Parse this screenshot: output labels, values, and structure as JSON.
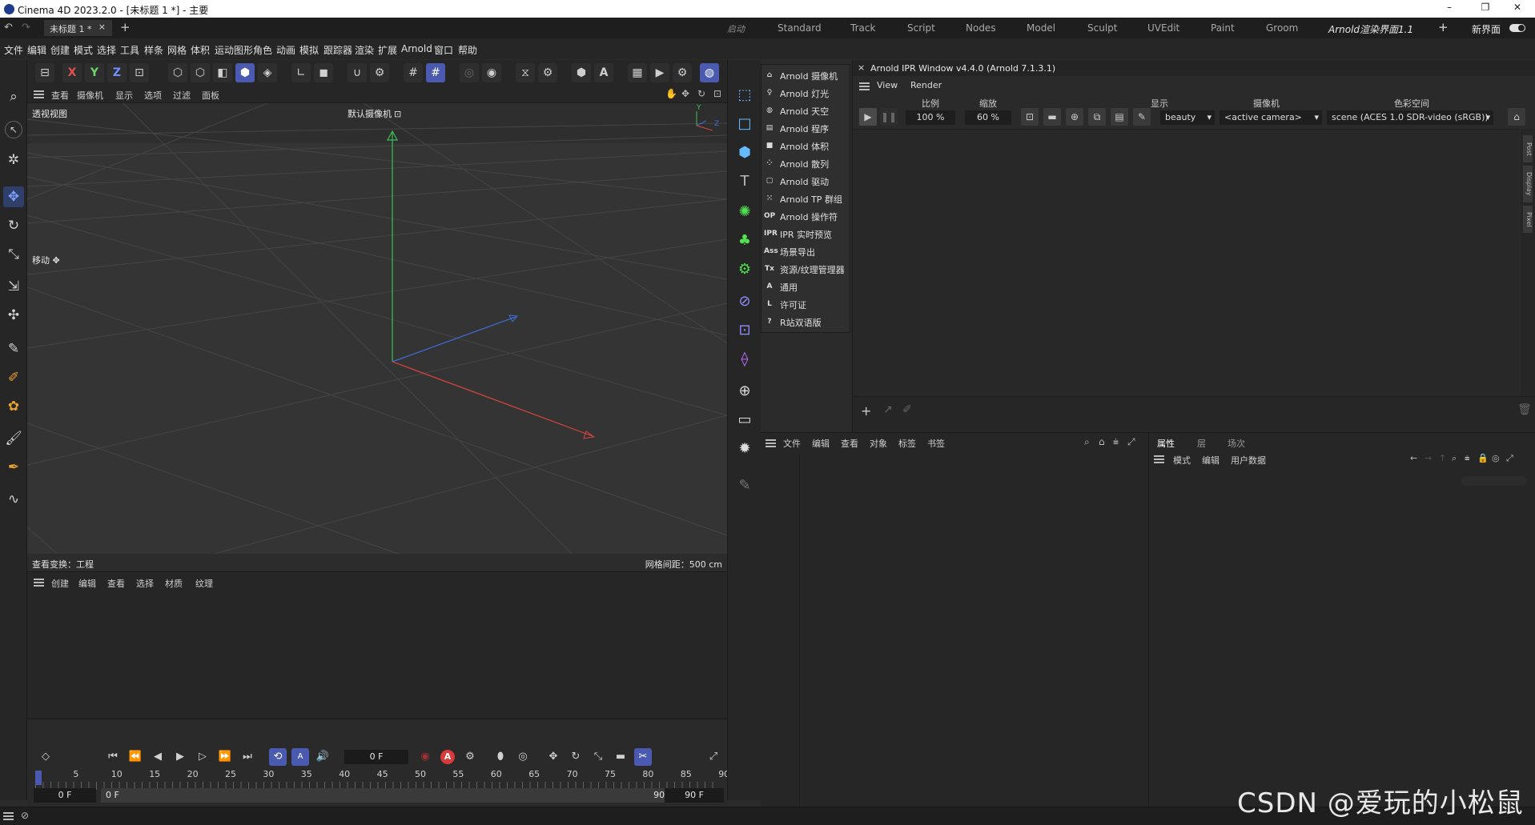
{
  "window": {
    "title": "Cinema 4D 2023.2.0 - [未标题 1 *] - 主要",
    "minimize": "–",
    "restore": "❐",
    "close": "✕"
  },
  "tabs": {
    "doc_tab": "未标题 1 *",
    "doc_close": "×",
    "add": "+",
    "layouts": [
      "启动",
      "Standard",
      "Track",
      "Script",
      "Nodes",
      "Model",
      "Sculpt",
      "UVEdit",
      "Paint",
      "Groom",
      "Arnold渲染界面1.1"
    ],
    "add_layout": "+",
    "new_layout": "新界面"
  },
  "menu": [
    "文件",
    "编辑",
    "创建",
    "模式",
    "选择",
    "工具",
    "样条",
    "网格",
    "体积",
    "运动图形",
    "角色",
    "动画",
    "模拟",
    "跟踪器",
    "渲染",
    "扩展",
    "Arnold",
    "窗口",
    "帮助"
  ],
  "toolbar": {
    "axis_x": "X",
    "axis_y": "Y",
    "axis_z": "Z"
  },
  "viewport": {
    "menu": [
      "查看",
      "摄像机",
      "显示",
      "选项",
      "过滤",
      "面板"
    ],
    "view_name": "透视视图",
    "camera": "默认摄像机",
    "camera_icon": "⊡",
    "tool_label": "移动",
    "tool_icon": "✥",
    "status_left": "查看变换：工程",
    "status_right": "网格间距：500 cm",
    "axis_y_label": "Y",
    "axis_z_label": "Z"
  },
  "material_panel": {
    "menu": [
      "创建",
      "编辑",
      "查看",
      "选择",
      "材质",
      "纹理"
    ]
  },
  "timeline": {
    "current_frame": "0 F",
    "ticks": [
      "0",
      "5",
      "10",
      "15",
      "20",
      "25",
      "30",
      "35",
      "40",
      "45",
      "50",
      "55",
      "60",
      "65",
      "70",
      "75",
      "80",
      "85",
      "90"
    ],
    "start_field": "0 F",
    "range_start": "0 F",
    "range_end": "90 F",
    "end_field": "90 F",
    "record_label": "A"
  },
  "arnold_menu": [
    {
      "icon": "⌂",
      "label": "Arnold 摄像机"
    },
    {
      "icon": "♀",
      "label": "Arnold 灯光"
    },
    {
      "icon": "◍",
      "label": "Arnold 天空"
    },
    {
      "icon": "▤",
      "label": "Arnold 程序"
    },
    {
      "icon": "■",
      "label": "Arnold 体积"
    },
    {
      "icon": "⁘",
      "label": "Arnold 散列"
    },
    {
      "icon": "▢",
      "label": "Arnold 驱动"
    },
    {
      "icon": "⁙",
      "label": "Arnold TP 群组"
    },
    {
      "icon": "OP",
      "label": "Arnold 操作符"
    },
    {
      "icon": "IPR",
      "label": "IPR 实时预览"
    },
    {
      "icon": "Ass",
      "label": "场景导出"
    },
    {
      "icon": "Tx",
      "label": "资源/纹理管理器"
    },
    {
      "icon": "A",
      "label": "通用"
    },
    {
      "icon": "L",
      "label": "许可证"
    },
    {
      "icon": "?",
      "label": "R站双语版"
    }
  ],
  "ipr": {
    "title": "Arnold IPR Window v4.4.0 (Arnold 7.1.3.1)",
    "close": "×",
    "menu": [
      "View",
      "Render"
    ],
    "scale_label": "比例",
    "scale_value": "100 %",
    "zoom_label": "缩放",
    "zoom_value": "60 %",
    "display_label": "显示",
    "display_value": "beauty",
    "camera_label": "摄像机",
    "camera_value": "<active camera>",
    "colorspace_label": "色彩空间",
    "colorspace_value": "scene (ACES 1.0 SDR-video (sRGB))",
    "side_tabs": [
      "Post",
      "Display",
      "Pixel"
    ]
  },
  "object_panel": {
    "menu": [
      "文件",
      "编辑",
      "查看",
      "对象",
      "标签",
      "书签"
    ]
  },
  "attr_panel": {
    "tabs": [
      "属性",
      "层",
      "场次"
    ],
    "menu": [
      "模式",
      "编辑",
      "用户数据"
    ]
  },
  "watermark": "CSDN @爱玩的小松鼠",
  "colors": {
    "accent": "#4a5ab0",
    "x_axis": "#d9443c",
    "y_axis": "#3fbf5a",
    "z_axis": "#3f6fd9"
  }
}
